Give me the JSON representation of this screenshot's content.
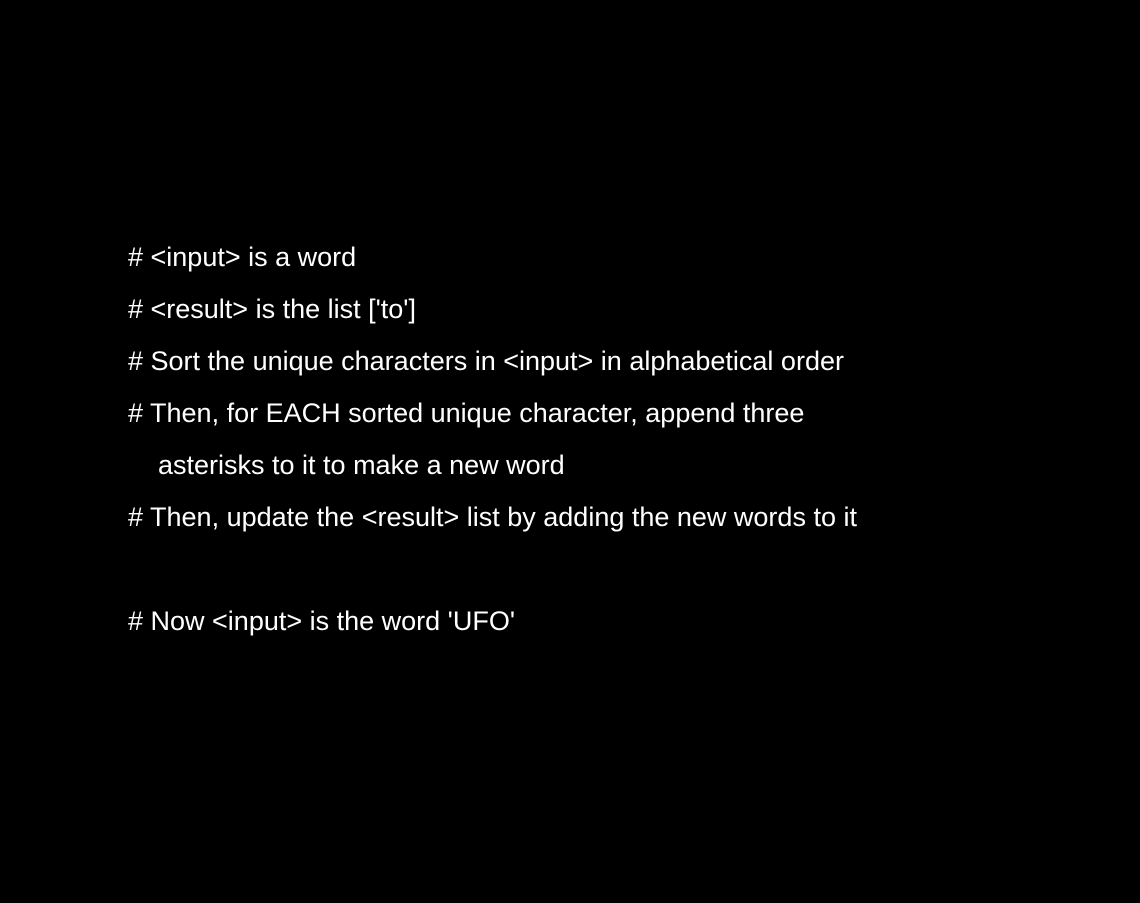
{
  "document": {
    "lines": [
      "# <input> is a word",
      "# <result> is the list ['to']",
      "# Sort the unique characters in <input> in alphabetical order",
      "# Then, for EACH sorted unique character, append three",
      "asterisks to it to make a new word",
      "# Then, update the <result> list by adding the new words to it",
      "",
      "# Now <input> is the word 'UFO'"
    ]
  },
  "colors": {
    "background": "#000000",
    "text": "#ffffff"
  }
}
